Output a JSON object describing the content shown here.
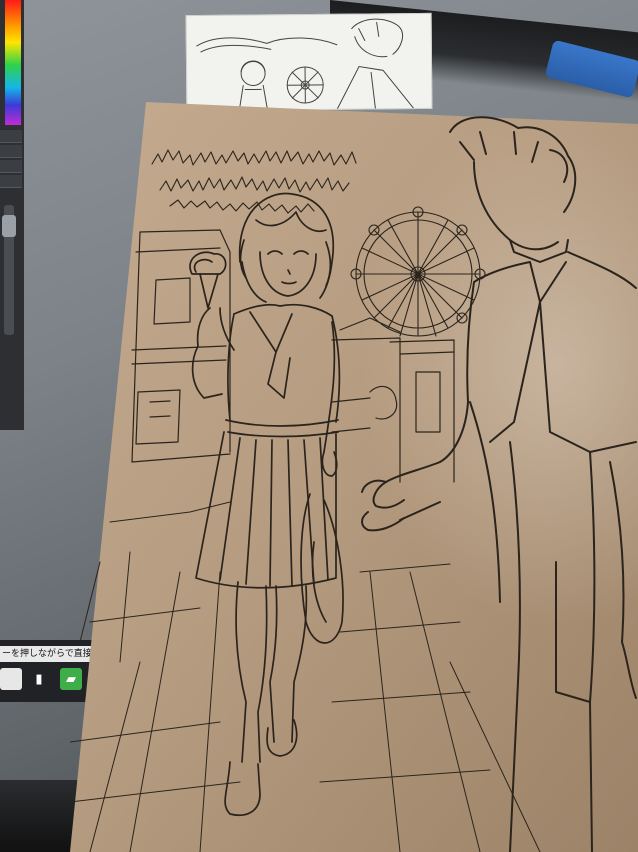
{
  "app_ui": {
    "hint_text": "ーを押しながらで直接描画",
    "panel_rows": [
      "",
      "",
      "",
      ""
    ]
  },
  "icons": {
    "slider": "slider-handle",
    "taskbar_1": "app-icon",
    "taskbar_2": "film-icon",
    "taskbar_3": "folder-icon"
  },
  "colors": {
    "paper": "#b89f82",
    "paper_shadow": "#8d7560",
    "ink": "#2b241d",
    "monitor": "#7c8287",
    "clip": "#3a77c9"
  }
}
